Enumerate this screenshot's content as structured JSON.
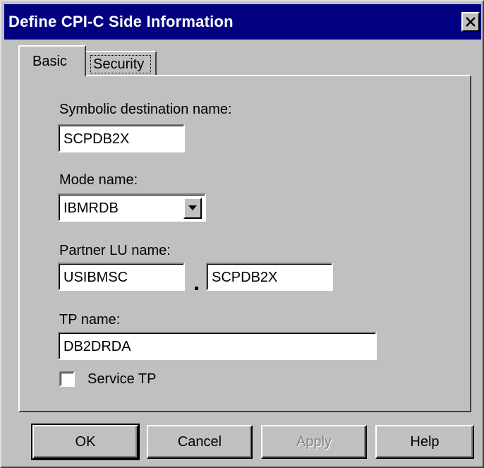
{
  "window": {
    "title": "Define CPI-C Side Information",
    "close_icon": "close-icon"
  },
  "tabs": [
    {
      "label": "Basic",
      "active": true
    },
    {
      "label": "Security",
      "active": false
    }
  ],
  "form": {
    "symbolic_destination": {
      "label": "Symbolic destination name:",
      "value": "SCPDB2X"
    },
    "mode": {
      "label": "Mode name:",
      "value": "IBMRDB"
    },
    "partner_lu": {
      "label": "Partner LU name:",
      "network_value": "USIBMSC",
      "separator": ".",
      "lu_value": "SCPDB2X"
    },
    "tp_name": {
      "label": "TP name:",
      "value": "DB2DRDA"
    },
    "service_tp": {
      "label": "Service TP",
      "checked": false
    }
  },
  "buttons": {
    "ok": "OK",
    "cancel": "Cancel",
    "apply": "Apply",
    "help": "Help"
  },
  "colors": {
    "titlebar": "#000080",
    "face": "#c0c0c0"
  }
}
